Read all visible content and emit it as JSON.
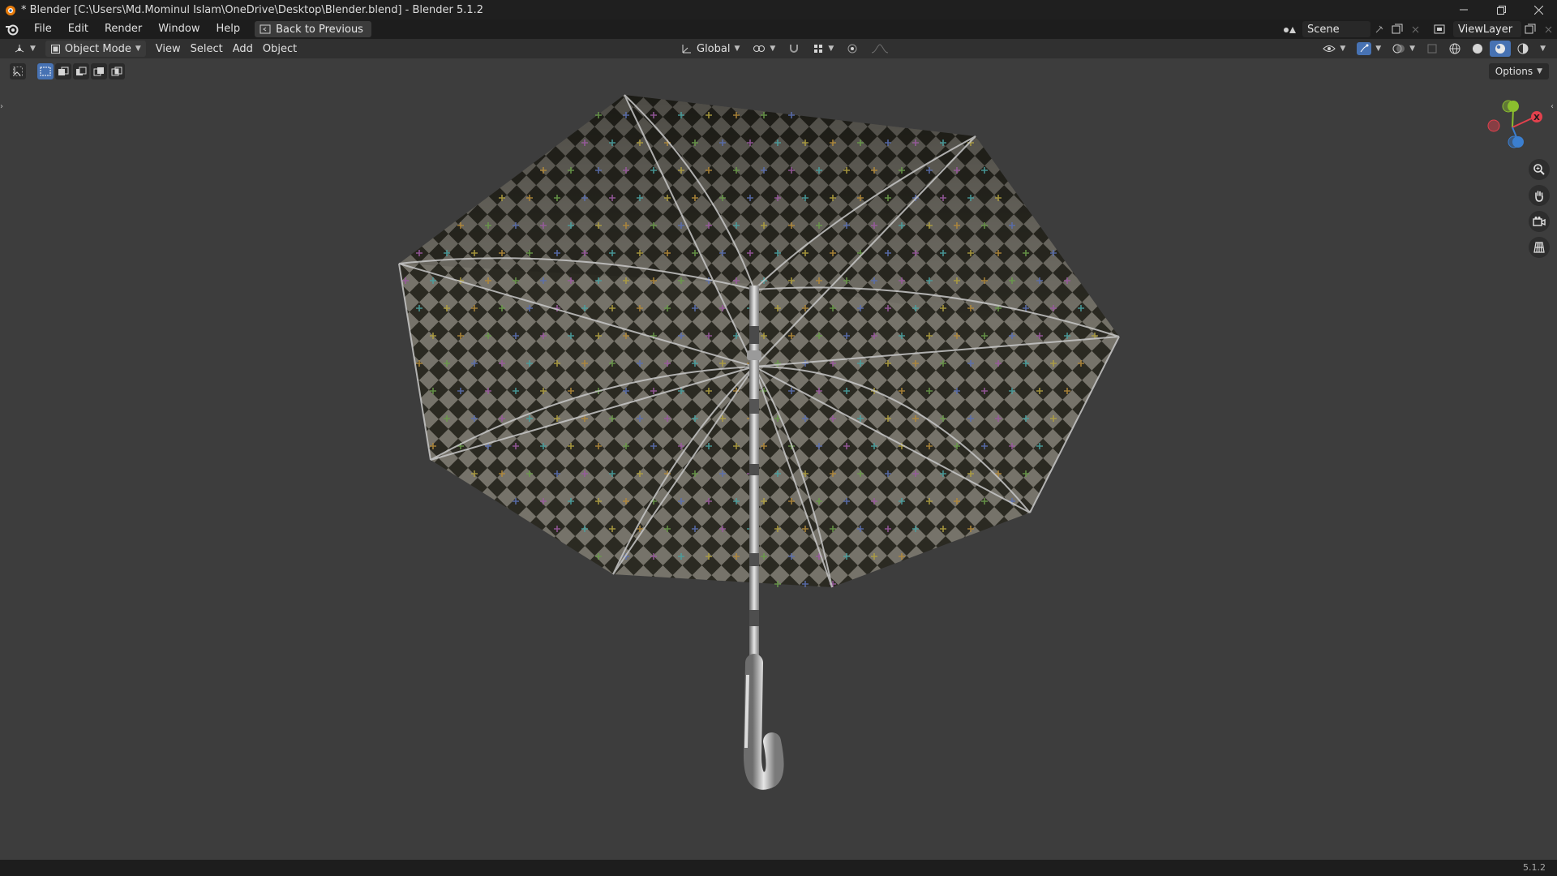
{
  "window": {
    "title": "* Blender [C:\\Users\\Md.Mominul Islam\\OneDrive\\Desktop\\Blender.blend] - Blender 5.1.2",
    "controls": [
      "minimize-icon",
      "restore-icon",
      "close-icon"
    ]
  },
  "topbar": {
    "menus": [
      "File",
      "Edit",
      "Render",
      "Window",
      "Help"
    ],
    "back_button": "Back to Previous",
    "scene": "Scene",
    "view_layer": "ViewLayer"
  },
  "viewport_header": {
    "mode": "Object Mode",
    "menus": [
      "View",
      "Select",
      "Add",
      "Object"
    ],
    "transform_orientation": "Global"
  },
  "viewport": {
    "options_label": "Options",
    "gizmo_axes": [
      "X",
      "Y",
      "Z"
    ],
    "nav_tools": [
      "zoom-icon",
      "pan-hand-icon",
      "camera-icon",
      "perspective-grid-icon"
    ]
  },
  "statusbar": {
    "version": "5.1.2"
  },
  "colors": {
    "accent": "#4772b3",
    "axis_x": "#e2414d",
    "axis_y": "#8bbf2e",
    "axis_z": "#3b7fd0"
  }
}
